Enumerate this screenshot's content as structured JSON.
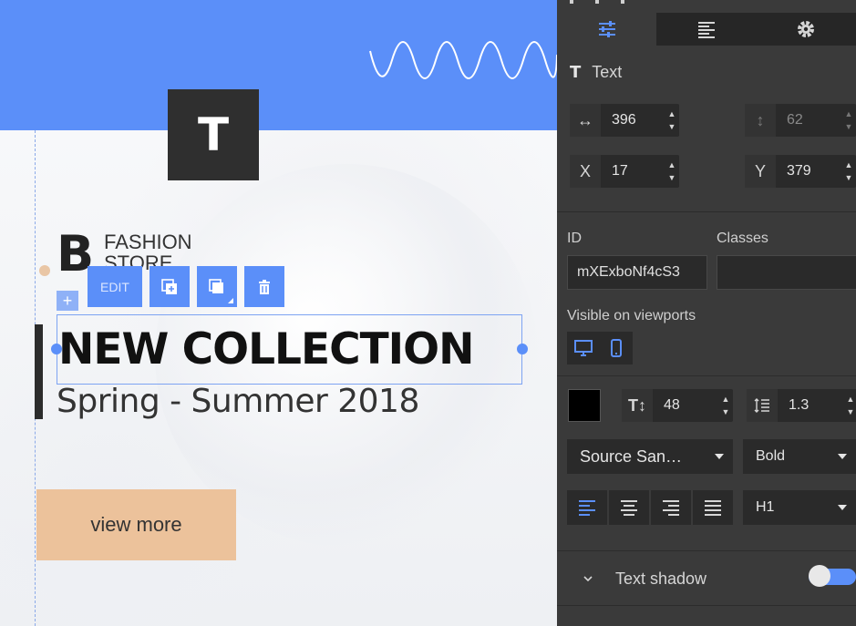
{
  "canvas": {
    "text_block_icon": "T",
    "brand": {
      "letter": "B",
      "name": "FASHION STORE"
    },
    "toolbar": {
      "edit_label": "EDIT",
      "add_handle": "+"
    },
    "heading": "NEW COLLECTION",
    "subheading": "Spring - Summer 2018",
    "cta_label": "view more",
    "accent_color": "#5b8ff9",
    "cta_color": "#ecc29b"
  },
  "panel": {
    "tabs": [
      {
        "icon": "sliders-icon",
        "active": true
      },
      {
        "icon": "align-left-icon",
        "active": false
      },
      {
        "icon": "gear-icon",
        "active": false
      }
    ],
    "element_type": {
      "icon": "T",
      "label": "Text"
    },
    "width": {
      "tag": "↔",
      "value": "396"
    },
    "height": {
      "tag": "↕",
      "value": "62"
    },
    "x": {
      "tag": "X",
      "value": "17"
    },
    "y": {
      "tag": "Y",
      "value": "379"
    },
    "id_label": "ID",
    "id_value": "mXExboNf4cS3",
    "classes_label": "Classes",
    "classes_value": "",
    "viewports_label": "Visible on viewports",
    "text_color": "#000000",
    "font_size": "48",
    "line_height": "1.3",
    "font_family": "Source San…",
    "font_weight": "Bold",
    "tag": "H1",
    "text_shadow_label": "Text shadow",
    "text_shadow_enabled": true
  }
}
